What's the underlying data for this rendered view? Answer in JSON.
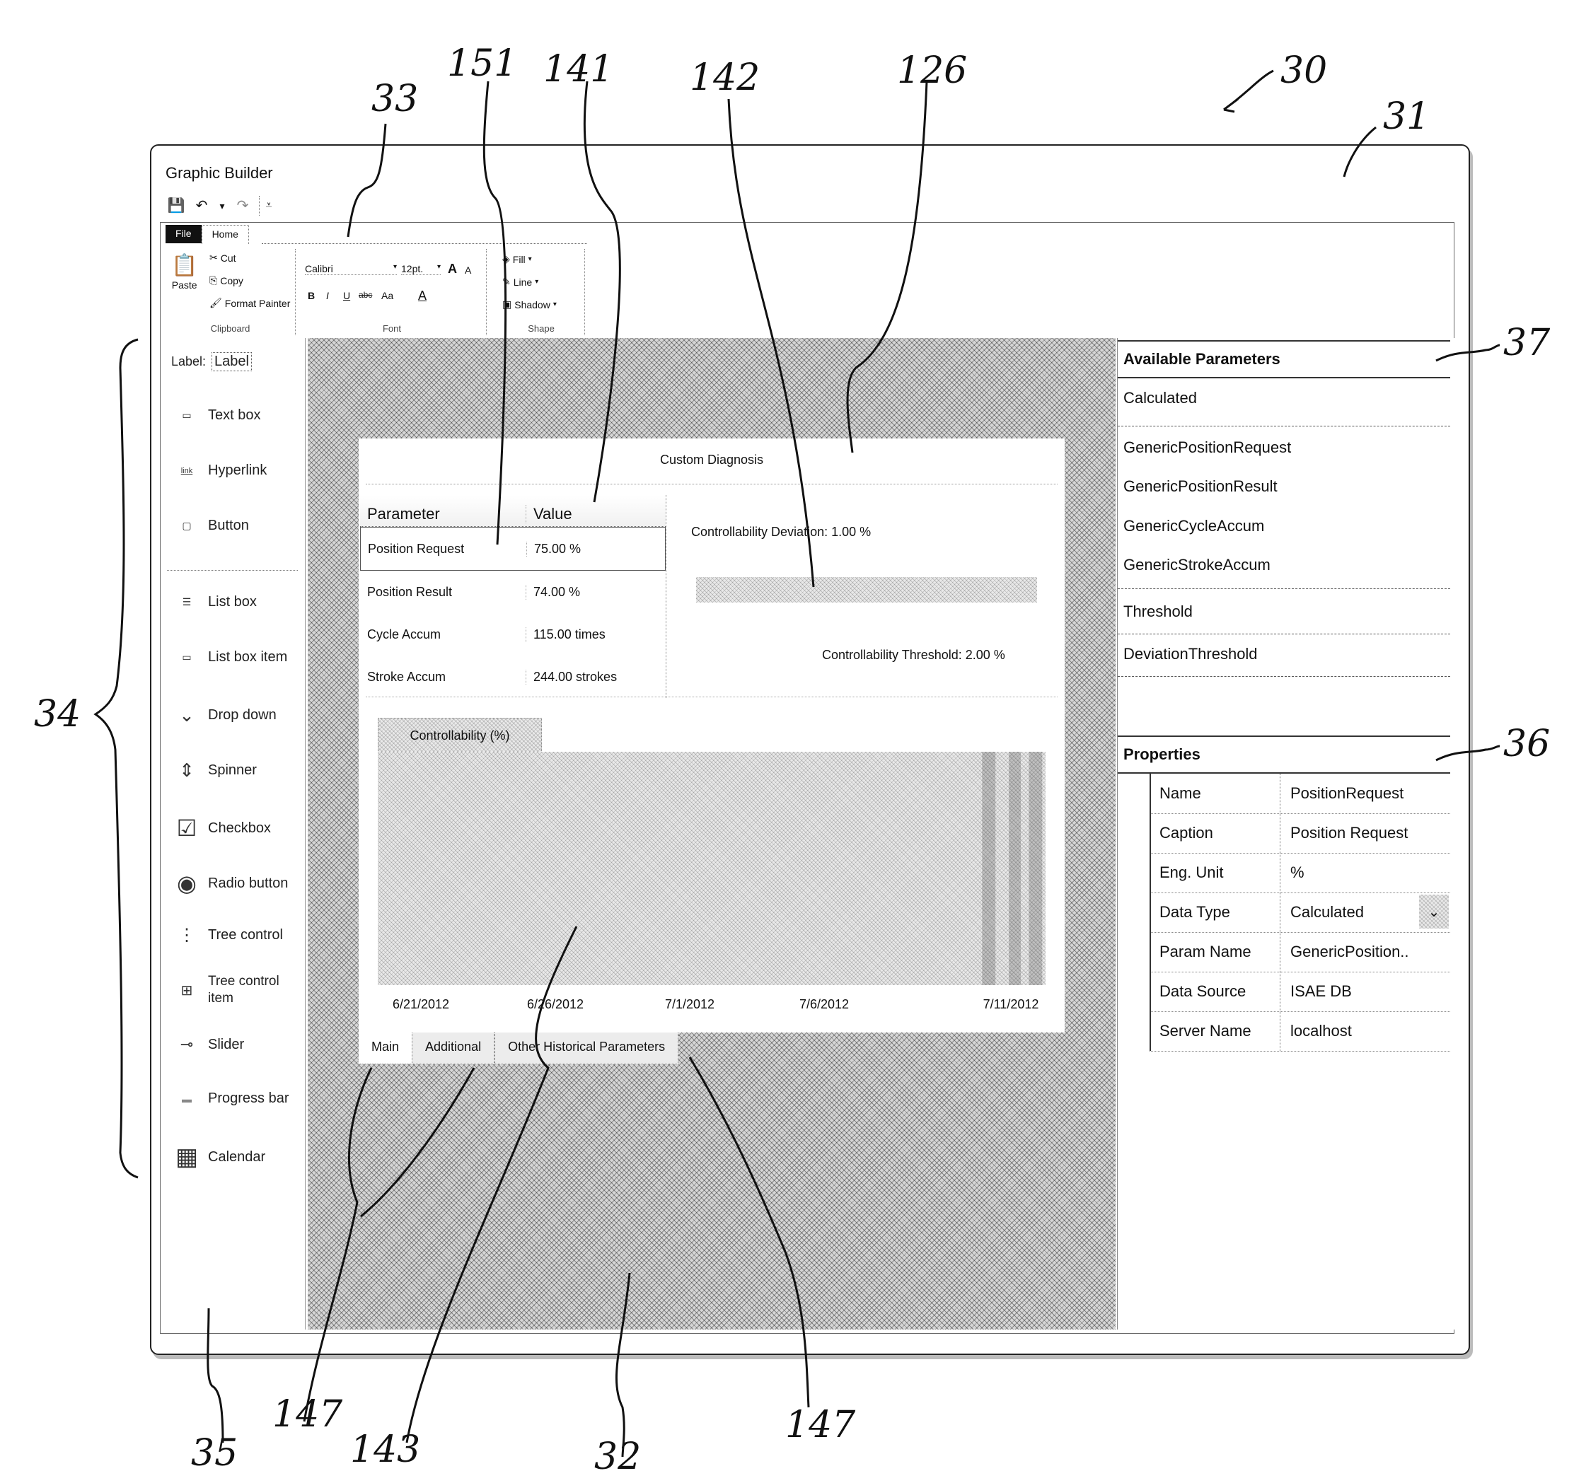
{
  "window": {
    "title": "Graphic Builder"
  },
  "quick_access": [
    {
      "icon": "save-icon",
      "glyph": "💾"
    },
    {
      "icon": "undo-icon",
      "glyph": "↶"
    },
    {
      "icon": "undo-dropdown-icon",
      "glyph": "▾"
    },
    {
      "icon": "redo-icon",
      "glyph": "↷"
    },
    {
      "icon": "customize-qat-icon",
      "glyph": "⩡"
    }
  ],
  "ribbon": {
    "tabs": [
      {
        "label": "File",
        "active": false
      },
      {
        "label": "Home",
        "active": true
      }
    ],
    "clipboard": {
      "group_label": "Clipboard",
      "paste": "Paste",
      "cut": "Cut",
      "copy": "Copy",
      "format_painter": "Format Painter"
    },
    "font": {
      "group_label": "Font",
      "font_name": "Calibri",
      "font_size": "12pt.",
      "grow": "A",
      "shrink": "A",
      "bold": "B",
      "italic": "I",
      "underline": "U",
      "strike": "abc",
      "change_case": "Aa",
      "font_color": "A"
    },
    "shape": {
      "group_label": "Shape",
      "fill": "Fill",
      "line": "Line",
      "shadow": "Shadow"
    }
  },
  "toolbox": [
    {
      "label": "Label",
      "icon": "label-control-icon",
      "glyph": "Label:"
    },
    {
      "label": "Text box",
      "icon": "textbox-control-icon",
      "glyph": "▭"
    },
    {
      "label": "Hyperlink",
      "icon": "hyperlink-control-icon",
      "glyph": "link"
    },
    {
      "label": "Button",
      "icon": "button-control-icon",
      "glyph": "▢"
    },
    {
      "label": "List box",
      "icon": "listbox-control-icon",
      "glyph": "☰"
    },
    {
      "label": "List box item",
      "icon": "listbox-item-control-icon",
      "glyph": "▭"
    },
    {
      "label": "Drop down",
      "icon": "dropdown-control-icon",
      "glyph": "⌄"
    },
    {
      "label": "Spinner",
      "icon": "spinner-control-icon",
      "glyph": "⇕"
    },
    {
      "label": "Checkbox",
      "icon": "checkbox-control-icon",
      "glyph": "☑"
    },
    {
      "label": "Radio button",
      "icon": "radio-control-icon",
      "glyph": "◉"
    },
    {
      "label": "Tree control",
      "icon": "tree-control-icon",
      "glyph": "⋮"
    },
    {
      "label": "Tree control item",
      "icon": "tree-item-control-icon",
      "glyph": "⊞"
    },
    {
      "label": "Slider",
      "icon": "slider-control-icon",
      "glyph": "⊸"
    },
    {
      "label": "Progress bar",
      "icon": "progressbar-control-icon",
      "glyph": "▬"
    },
    {
      "label": "Calendar",
      "icon": "calendar-control-icon",
      "glyph": "▦"
    }
  ],
  "toolbox_label_sample": "Label",
  "diagnosis": {
    "title": "Custom Diagnosis",
    "table": {
      "headers": [
        "Parameter",
        "Value"
      ],
      "rows": [
        {
          "parameter": "Position Request",
          "value": "75.00 %",
          "selected": true
        },
        {
          "parameter": "Position Result",
          "value": "74.00 %",
          "selected": false
        },
        {
          "parameter": "Cycle Accum",
          "value": "115.00 times",
          "selected": false
        },
        {
          "parameter": "Stroke Accum",
          "value": "244.00 strokes",
          "selected": false
        }
      ]
    },
    "deviation_label": "Controllability Deviation: 1.00 %",
    "deviation_bar_fill_fraction": 1.0,
    "threshold_label": "Controllability Threshold: 2.00 %",
    "chart_tab": "Controllability (%)",
    "bottom_tabs": [
      {
        "label": "Main",
        "active": true
      },
      {
        "label": "Additional",
        "active": false
      },
      {
        "label": "Other Historical Parameters",
        "active": false
      }
    ]
  },
  "chart_data": {
    "type": "area",
    "title": "Controllability (%)",
    "xlabel": "",
    "ylabel": "",
    "x_tick_labels": [
      "6/21/2012",
      "6/26/2012",
      "7/1/2012",
      "7/6/2012",
      "7/11/2012"
    ],
    "series": [],
    "grid": false,
    "note": "Plot area is filled with a stippled background; no data values are legible"
  },
  "available_parameters": {
    "title": "Available Parameters",
    "groups": [
      {
        "name": "Calculated",
        "items": [
          "GenericPositionRequest",
          "GenericPositionResult",
          "GenericCycleAccum",
          "GenericStrokeAccum"
        ]
      },
      {
        "name": "Threshold",
        "items": [
          "DeviationThreshold"
        ]
      }
    ]
  },
  "properties": {
    "title": "Properties",
    "rows": [
      {
        "label": "Name",
        "value": "PositionRequest"
      },
      {
        "label": "Caption",
        "value": "Position Request"
      },
      {
        "label": "Eng. Unit",
        "value": "%"
      },
      {
        "label": "Data Type",
        "value": "Calculated",
        "dropdown": true
      },
      {
        "label": "Param Name",
        "value": "GenericPosition.."
      },
      {
        "label": "Data Source",
        "value": "ISAE DB"
      },
      {
        "label": "Server Name",
        "value": "localhost"
      }
    ]
  },
  "reference_numerals": {
    "r30": "30",
    "r31": "31",
    "r33": "33",
    "r151": "151",
    "r141": "141",
    "r142": "142",
    "r126": "126",
    "r37": "37",
    "r36": "36",
    "r34": "34",
    "r35": "35",
    "r147a": "147",
    "r143": "143",
    "r32": "32",
    "r147b": "147"
  }
}
